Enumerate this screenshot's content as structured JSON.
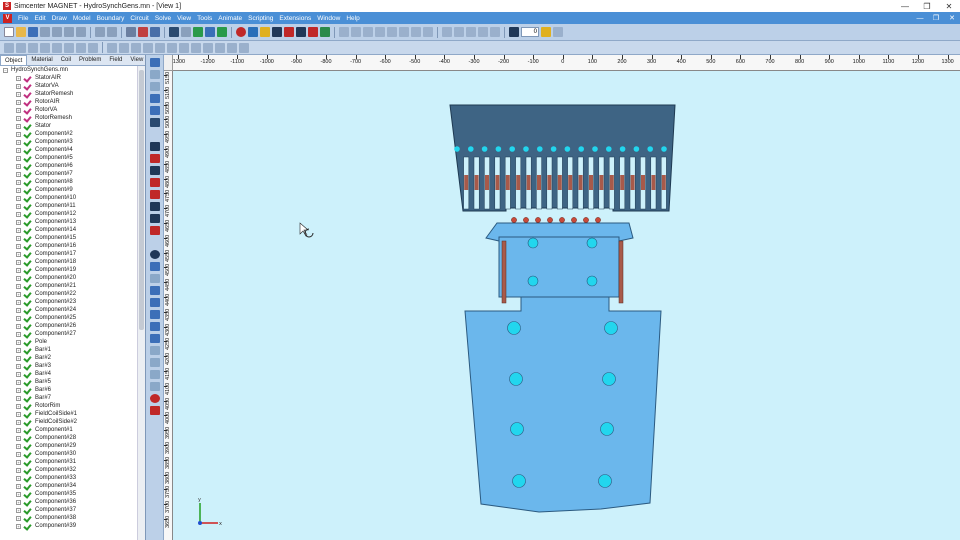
{
  "window": {
    "title": "Simcenter MAGNET - HydroSynchGens.mn - [View 1]",
    "logo_glyph": "S",
    "minimize_icon": "—",
    "restore_icon": "❐",
    "close_icon": "✕"
  },
  "menubar": {
    "logo_glyph": "V",
    "items": [
      "File",
      "Edit",
      "Draw",
      "Model",
      "Boundary",
      "Circuit",
      "Solve",
      "View",
      "Tools",
      "Animate",
      "Scripting",
      "Extensions",
      "Window",
      "Help"
    ],
    "mdi_minimize_icon": "—",
    "mdi_restore_icon": "❐",
    "mdi_close_icon": "✕"
  },
  "toolbar": {
    "zoom_value": "0"
  },
  "panel_tabs": [
    "Object",
    "Material",
    "Coil",
    "Problem",
    "Field",
    "View"
  ],
  "tree": {
    "root": "HydroSynchGens.mn",
    "items": [
      {
        "label": "StatorAIR",
        "status": "pink"
      },
      {
        "label": "StatorVA",
        "status": "pink"
      },
      {
        "label": "StatorRemesh",
        "status": "pink"
      },
      {
        "label": "RotorAIR",
        "status": "pink"
      },
      {
        "label": "RotorVA",
        "status": "pink"
      },
      {
        "label": "RotorRemesh",
        "status": "pink"
      },
      {
        "label": "Stator",
        "status": "green"
      },
      {
        "label": "Component#2",
        "status": "green"
      },
      {
        "label": "Component#3",
        "status": "green"
      },
      {
        "label": "Component#4",
        "status": "green"
      },
      {
        "label": "Component#5",
        "status": "green"
      },
      {
        "label": "Component#6",
        "status": "green"
      },
      {
        "label": "Component#7",
        "status": "green"
      },
      {
        "label": "Component#8",
        "status": "green"
      },
      {
        "label": "Component#9",
        "status": "green"
      },
      {
        "label": "Component#10",
        "status": "green"
      },
      {
        "label": "Component#11",
        "status": "green"
      },
      {
        "label": "Component#12",
        "status": "green"
      },
      {
        "label": "Component#13",
        "status": "green"
      },
      {
        "label": "Component#14",
        "status": "green"
      },
      {
        "label": "Component#15",
        "status": "green"
      },
      {
        "label": "Component#16",
        "status": "green"
      },
      {
        "label": "Component#17",
        "status": "green"
      },
      {
        "label": "Component#18",
        "status": "green"
      },
      {
        "label": "Component#19",
        "status": "green"
      },
      {
        "label": "Component#20",
        "status": "green"
      },
      {
        "label": "Component#21",
        "status": "green"
      },
      {
        "label": "Component#22",
        "status": "green"
      },
      {
        "label": "Component#23",
        "status": "green"
      },
      {
        "label": "Component#24",
        "status": "green"
      },
      {
        "label": "Component#25",
        "status": "green"
      },
      {
        "label": "Component#26",
        "status": "green"
      },
      {
        "label": "Component#27",
        "status": "green"
      },
      {
        "label": "Pole",
        "status": "green"
      },
      {
        "label": "Bar#1",
        "status": "green"
      },
      {
        "label": "Bar#2",
        "status": "green"
      },
      {
        "label": "Bar#3",
        "status": "green"
      },
      {
        "label": "Bar#4",
        "status": "green"
      },
      {
        "label": "Bar#5",
        "status": "green"
      },
      {
        "label": "Bar#6",
        "status": "green"
      },
      {
        "label": "Bar#7",
        "status": "green"
      },
      {
        "label": "RotorRim",
        "status": "green"
      },
      {
        "label": "FieldCoilSide#1",
        "status": "green"
      },
      {
        "label": "FieldCoilSide#2",
        "status": "green"
      },
      {
        "label": "Component#1",
        "status": "green"
      },
      {
        "label": "Component#28",
        "status": "green"
      },
      {
        "label": "Component#29",
        "status": "green"
      },
      {
        "label": "Component#30",
        "status": "green"
      },
      {
        "label": "Component#31",
        "status": "green"
      },
      {
        "label": "Component#32",
        "status": "green"
      },
      {
        "label": "Component#33",
        "status": "green"
      },
      {
        "label": "Component#34",
        "status": "green"
      },
      {
        "label": "Component#35",
        "status": "green"
      },
      {
        "label": "Component#36",
        "status": "green"
      },
      {
        "label": "Component#37",
        "status": "green"
      },
      {
        "label": "Component#38",
        "status": "green"
      },
      {
        "label": "Component#39",
        "status": "green"
      }
    ]
  },
  "ruler": {
    "h_labels": [
      "-1300",
      "-1200",
      "-1100",
      "-1000",
      "-900",
      "-800",
      "-700",
      "-600",
      "-500",
      "-400",
      "-300",
      "-200",
      "-100",
      "0",
      "100",
      "200",
      "300",
      "400",
      "500",
      "600",
      "700",
      "800",
      "900",
      "1000",
      "1100",
      "1200",
      "1300"
    ],
    "v_labels": [
      "5150",
      "5100",
      "5050",
      "5000",
      "4950",
      "4900",
      "4850",
      "4800",
      "4750",
      "4700",
      "4650",
      "4600",
      "4550",
      "4500",
      "4450",
      "4400",
      "4350",
      "4300",
      "4250",
      "4200",
      "4150",
      "4100",
      "4050",
      "4000",
      "3950",
      "3900",
      "3850",
      "3800",
      "3750",
      "3700",
      "3650"
    ]
  },
  "axis": {
    "y_label": "y",
    "x_label": "x"
  },
  "colors": {
    "canvas_bg": "#cdf1fb",
    "stator_steel": "#3e6484",
    "rotor_steel": "#6bb7ec",
    "winding_copper": "#a85a4a",
    "cooling_hole": "#22d6ee",
    "damper_bar": "#c74a3a"
  }
}
